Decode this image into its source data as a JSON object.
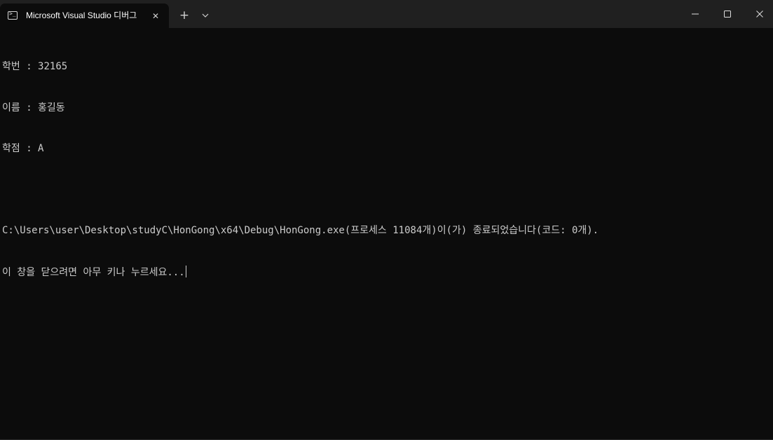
{
  "window": {
    "tab_title": "Microsoft Visual Studio 디버그",
    "tab_icon": "terminal-icon",
    "tab_close_glyph": "✕",
    "new_tab_glyph": "+",
    "dropdown_icon": "chevron-down-icon",
    "controls": [
      "minimize-icon",
      "maximize-icon",
      "close-icon"
    ]
  },
  "console": {
    "lines": [
      "학번 : 32165",
      "이름 : 홍길동",
      "학점 : A",
      "",
      "C:\\Users\\user\\Desktop\\studyC\\HonGong\\x64\\Debug\\HonGong.exe(프로세스 11084개)이(가) 종료되었습니다(코드: 0개).",
      "이 창을 닫으려면 아무 키나 누르세요..."
    ]
  },
  "colors": {
    "background": "#0c0c0c",
    "titlebar": "#202020",
    "text": "#cccccc"
  }
}
